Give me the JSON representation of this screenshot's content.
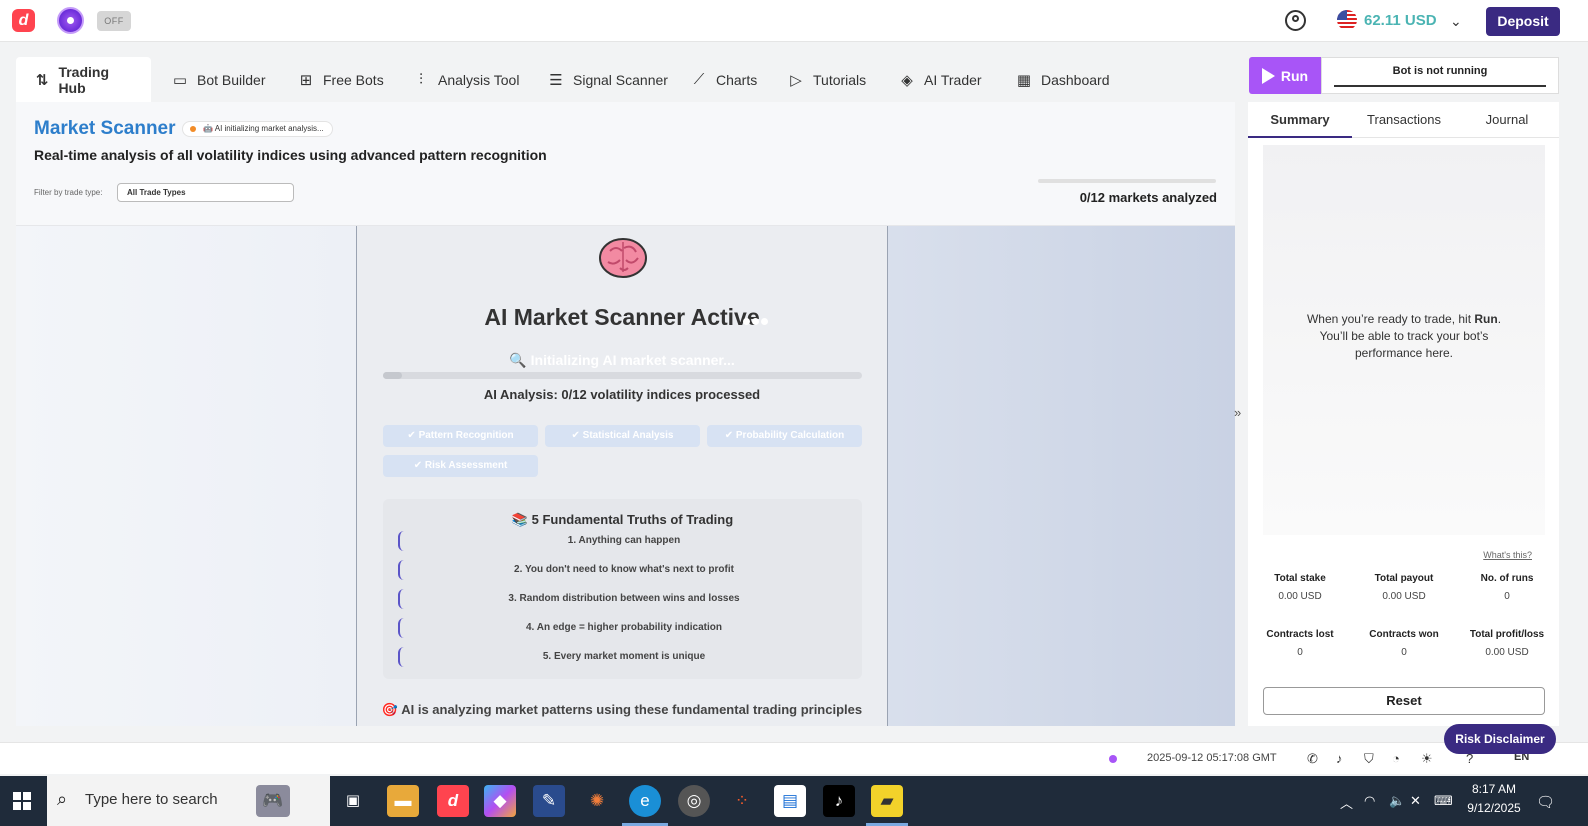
{
  "header": {
    "toggle_state": "OFF",
    "balance": "62.11 USD",
    "deposit_label": "Deposit"
  },
  "tabs": [
    {
      "label": "Trading Hub",
      "icon": "arrows-updown-icon"
    },
    {
      "label": "Bot Builder",
      "icon": "bot-builder-icon"
    },
    {
      "label": "Free Bots",
      "icon": "grid-plus-icon"
    },
    {
      "label": "Analysis Tool",
      "icon": "analysis-icon"
    },
    {
      "label": "Signal Scanner",
      "icon": "list-icon"
    },
    {
      "label": "Charts",
      "icon": "line-chart-icon"
    },
    {
      "label": "Tutorials",
      "icon": "play-icon"
    },
    {
      "label": "AI Trader",
      "icon": "layers-icon"
    },
    {
      "label": "Dashboard",
      "icon": "dashboard-icon"
    }
  ],
  "scanner": {
    "title": "Market Scanner",
    "badge": "🤖 AI initializing market analysis...",
    "subtitle": "Real-time analysis of all volatility indices using advanced pattern recognition",
    "filter_label": "Filter by trade type:",
    "filter_value": "All Trade Types",
    "markets_analyzed": "0/12 markets analyzed",
    "card_title": "AI Market Scanner Active",
    "init_text": "Initializing AI market scanner...",
    "analysis_text": "AI Analysis: 0/12 volatility indices processed",
    "progress": 0.04,
    "chips": [
      "✔ Pattern Recognition",
      "✔ Statistical Analysis",
      "✔ Probability Calculation",
      "✔ Risk Assessment"
    ],
    "truths_title": "5 Fundamental Truths of Trading",
    "truths": [
      "1. Anything can happen",
      "2. You don't need to know what's next to profit",
      "3. Random distribution between wins and losses",
      "4. An edge = higher probability indication",
      "5. Every market moment is unique"
    ],
    "footer_note": "AI is analyzing market patterns using these fundamental trading principles"
  },
  "run_panel": {
    "run_label": "Run",
    "status": "Bot is not running",
    "tabs": [
      "Summary",
      "Transactions",
      "Journal"
    ],
    "empty_line1_pre": "When you’re ready to trade, hit ",
    "empty_line1_bold": "Run",
    "empty_line1_post": ".",
    "empty_line2": "You’ll be able to track your bot’s",
    "empty_line3": "performance here.",
    "whats_this": "What's this?",
    "stats": [
      {
        "label": "Total stake",
        "value": "0.00 USD"
      },
      {
        "label": "Total payout",
        "value": "0.00 USD"
      },
      {
        "label": "No. of runs",
        "value": "0"
      },
      {
        "label": "Contracts lost",
        "value": "0"
      },
      {
        "label": "Contracts won",
        "value": "0"
      },
      {
        "label": "Total profit/loss",
        "value": "0.00 USD"
      }
    ],
    "reset_label": "Reset",
    "risk_label": "Risk Disclaimer"
  },
  "statusbar": {
    "time": "2025-09-12 05:17:08 GMT",
    "language": "EN"
  },
  "taskbar": {
    "search_placeholder": "Type here to search",
    "time": "8:17 AM",
    "date": "9/12/2025"
  }
}
